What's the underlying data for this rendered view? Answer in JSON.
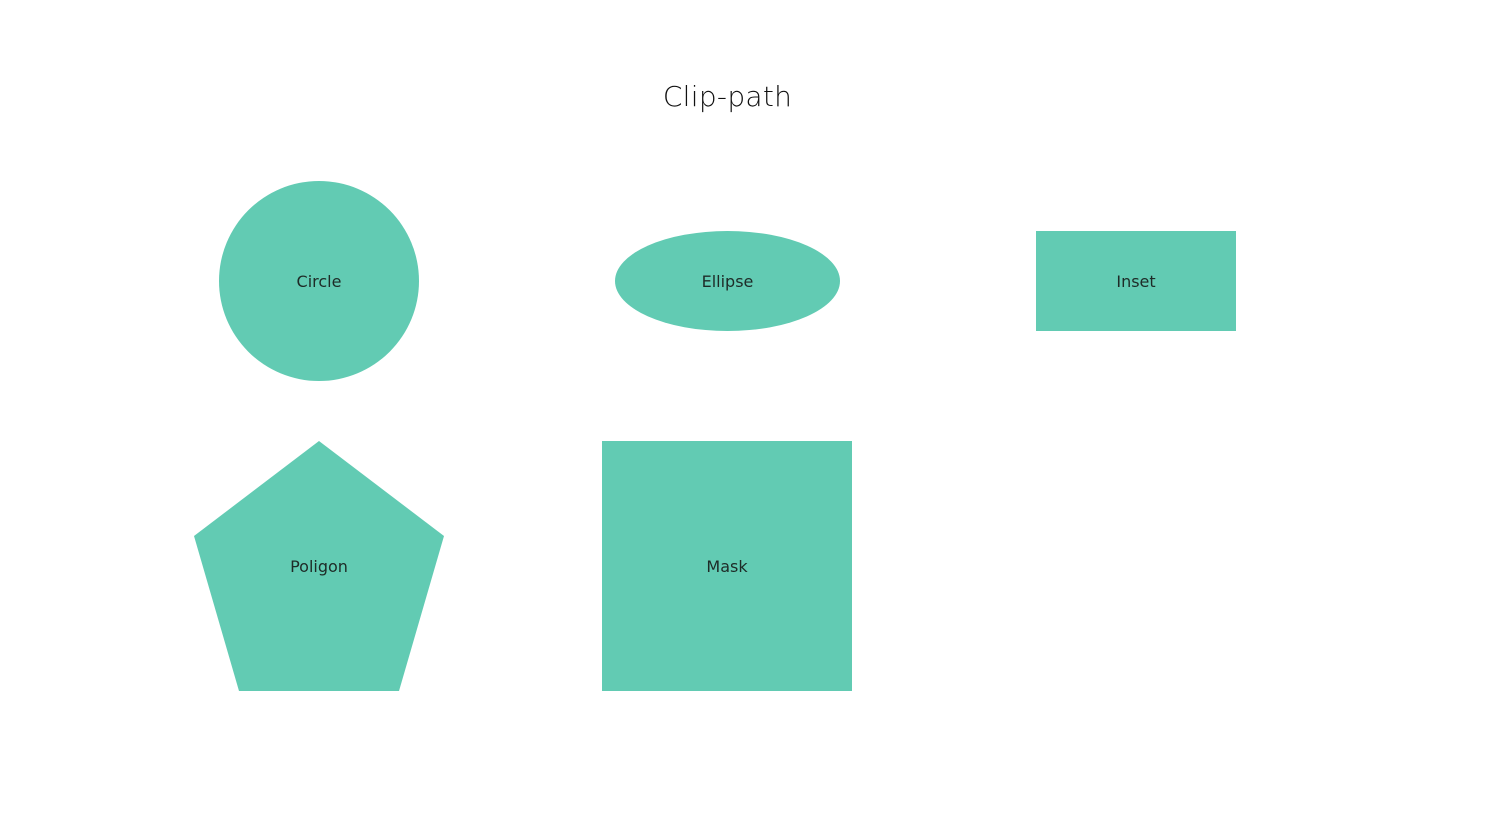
{
  "page": {
    "title": "Clip-path"
  },
  "shapes": {
    "circle": {
      "label": "Circle"
    },
    "ellipse": {
      "label": "Ellipse"
    },
    "inset": {
      "label": "Inset"
    },
    "polygon": {
      "label": "Poligon"
    },
    "mask": {
      "label": "Mask"
    }
  },
  "colors": {
    "shape_fill": "#62cbb3",
    "background": "#ffffff"
  }
}
